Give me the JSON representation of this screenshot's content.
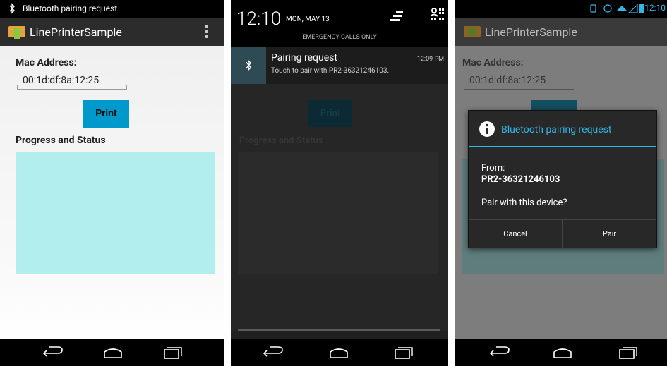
{
  "panel1": {
    "status_text": "Bluetooth pairing request",
    "app_title": "LinePrinterSample",
    "mac_label": "Mac Address:",
    "mac_value": "00:1d:df:8a:12:25",
    "print_label": "Print",
    "progress_label": "Progress and Status",
    "status_area_color": "#b3eeee"
  },
  "panel2": {
    "clock": "12:10",
    "date": "MON, MAY 13",
    "emergency": "EMERGENCY CALLS ONLY",
    "notification": {
      "title": "Pairing request",
      "text": "Touch to pair with PR2-36321246103.",
      "time": "12:09 PM"
    },
    "ghost_print": "Print",
    "ghost_progress": "Progress and Status"
  },
  "panel3": {
    "status_time": "12:10",
    "app_title": "LinePrinterSample",
    "mac_label": "Mac Address:",
    "mac_value": "00:1d:df:8a:12:25",
    "dialog": {
      "title": "Bluetooth pairing request",
      "from_label": "From:",
      "device": "PR2-36321246103",
      "question": "Pair with this device?",
      "cancel": "Cancel",
      "pair": "Pair"
    }
  },
  "colors": {
    "accent": "#33b5e5",
    "print_button": "#0099cc",
    "status_area": "#b3eeee"
  }
}
